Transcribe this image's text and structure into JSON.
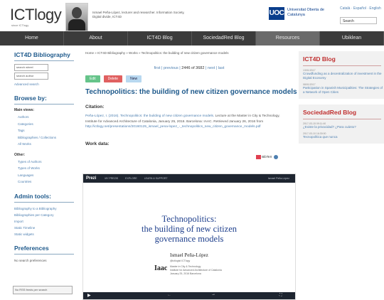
{
  "header": {
    "logo": "ICTlogy",
    "logo_sub": "since ICTlogy",
    "tagline": "Ismael Peña-López, lecturer and researcher. Information Society, Digital divide, ICT4D",
    "uoc_logo": "UOC",
    "uoc_name": "Universitat Oberta de Catalunya",
    "lang": "Català · Español · English",
    "search_value": "Search"
  },
  "nav": {
    "items": [
      "Home",
      "About",
      "ICT4D Blog",
      "SociedadRed Blog",
      "Resources",
      "Ubiklean"
    ]
  },
  "sidebar": {
    "title": "ICT4D Bibliography",
    "search_inputs": [
      "search wheel",
      "search author"
    ],
    "advanced": "Advanced search",
    "browse_title": "Browse by:",
    "main_views": "Main views:",
    "main_items": [
      "Authors",
      "Categories",
      "Tags",
      "Bibliographies / Collections",
      "All Works"
    ],
    "other": "Other:",
    "other_items": [
      "Types of Authors",
      "Types of Works",
      "Languages",
      "Countries"
    ],
    "admin_title": "Admin tools:",
    "admin_items": [
      "Bibliography to a Bibliography",
      "Bibliographies per Category",
      "Import",
      "Static Timeline",
      "Static widgets"
    ],
    "prefs_title": "Preferences",
    "prefs_text": "No search preferences",
    "cookie_value": "No RSS feeds per search"
  },
  "main": {
    "breadcrumb": "Home » ICT4D Bibliography » Works » Technopolitics: the building of new citizen governance models",
    "pager": {
      "first": "first",
      "previous": "previous",
      "current": "2446 of 3682",
      "next": "next",
      "last": "last"
    },
    "actions": [
      "Edit",
      "Delete",
      "New"
    ],
    "title": "Technopolitics: the building of new citizen governance models",
    "citation_label": "Citation:",
    "bibtex": "BibTeX",
    "citation_author": "Peña-López, I. (2016).",
    "citation_work": "Technopolitics: the building of new citizen governance models.",
    "citation_rest": "Lecture at the Master in City & Technology, Institute for Advanced Architecture of Catalonia, January 25, 2016. Barcelona: IAAC. Retrieved January 26, 2016 from",
    "citation_url": "http://ictlogy.net/presentations/20160125_ismael_pena-lopez_-_technopolitics_new_citizen_governance_models.pdf",
    "work_data_label": "Work data:"
  },
  "prezi": {
    "logo": "Prezi",
    "tabs": [
      "MY PREZIS",
      "EXPLORE",
      "LEARN & SUPPORT"
    ],
    "login": "Ismael Peña-López",
    "title_line1": "Technopolitics:",
    "title_line2": "the building of new citizen",
    "title_line3": "governance models",
    "author": "Ismael Peña-López",
    "handle": "@ictlogist      ICTlogy",
    "institution": "Master in City & Technology\nInstitute for Advanced Architecture of Catalonia\nJanuary 25, 2016 Barcelona",
    "iaac_logo": "Iaac"
  },
  "right": {
    "blog_title": "ICT4D Blog",
    "blog_posts": [
      {
        "date": "13/01/2017",
        "title": "Crowdfunding as a decentralization of investment in the Digital Economy"
      },
      {
        "date": "08/01/2017",
        "title": "Participation in Spanish Municipalities: The Strategies of a Network of Open Cities"
      }
    ],
    "red_title": "SociedadRed Blog",
    "red_posts": [
      {
        "date": "2017-03-15 09:11:40",
        "title": "¿Existe la privacidad? ¿Para cuánto?"
      },
      {
        "date": "2017-03-10 16:30:00",
        "title": "Tecnopolítica que nunca"
      }
    ]
  },
  "colors": {
    "accent": "#1f5a8c",
    "nav_bg": "#3b3b3b",
    "red_title": "#c03030",
    "prezi_title": "#1e3f8c"
  }
}
